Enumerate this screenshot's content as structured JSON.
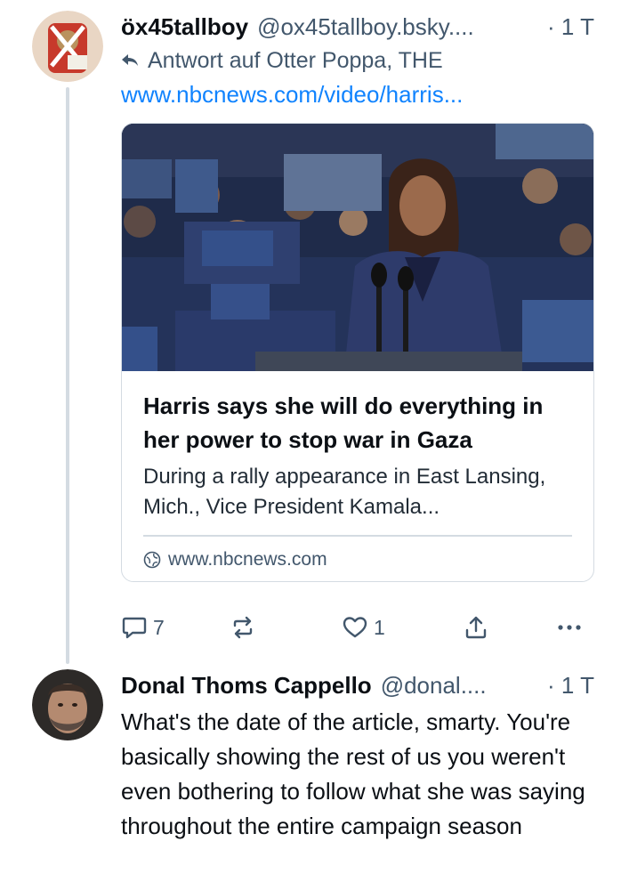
{
  "posts": [
    {
      "author": "öx45tallboy",
      "handle": "@ox45tallboy.bsky....",
      "time": "· 1 T",
      "reply_to": "Antwort auf Otter Poppa, THE",
      "link": "www.nbcnews.com/video/harris...",
      "card": {
        "title": "Harris says she will do everything in her power to stop war in Gaza",
        "description": "During a rally appearance in East Lansing, Mich., Vice President Kamala...",
        "domain": "www.nbcnews.com"
      },
      "actions": {
        "replies": "7",
        "likes": "1"
      }
    },
    {
      "author": "Donal Thoms Cappello",
      "handle": "@donal....",
      "time": "· 1 T",
      "text": "What's the date of the article, smarty. You're basically showing the rest of us you weren't even bothering to follow what she was saying throughout the entire campaign season"
    }
  ],
  "colors": {
    "link": "#1083fe",
    "muted": "#42576c",
    "border": "#d4dbe2",
    "text": "#0b0f14"
  },
  "icons": [
    "reply-arrow-icon",
    "comment-icon",
    "repost-icon",
    "heart-icon",
    "share-icon",
    "more-icon",
    "globe-icon"
  ]
}
